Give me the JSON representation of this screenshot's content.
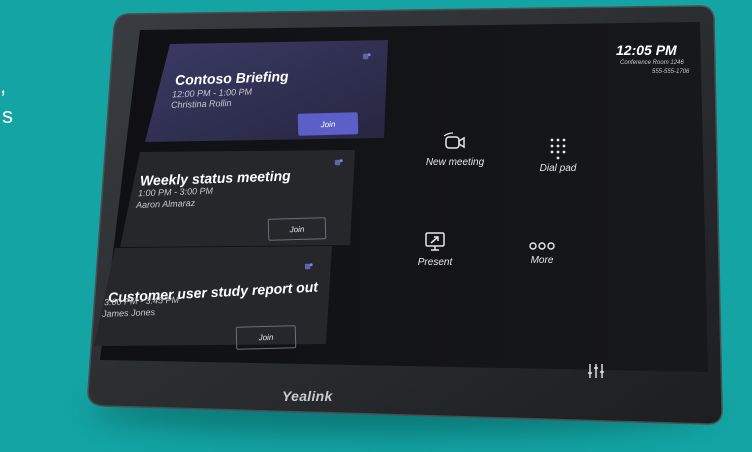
{
  "background_text": [
    ",",
    "s"
  ],
  "status": {
    "time": "12:05 PM",
    "room": "Conference Room 1246",
    "phone": "555-555-1706"
  },
  "meetings": [
    {
      "title": "Contoso Briefing",
      "time": "12:00 PM - 1:00 PM",
      "host": "Christina Rollin",
      "join_label": "Join"
    },
    {
      "title": "Weekly status meeting",
      "time": "1:00 PM - 3:00 PM",
      "host": "Aaron Almaraz",
      "join_label": "Join"
    },
    {
      "title": "Customer user study report out",
      "time": "3:00 PM - 3:45 PM",
      "host": "James Jones",
      "join_label": "Join"
    }
  ],
  "actions": {
    "new_meeting": "New meeting",
    "dial_pad": "Dial pad",
    "present": "Present",
    "more": "More"
  },
  "brand": "Yealink",
  "colors": {
    "accent": "#5b5fc7",
    "background": "#13a4a3",
    "screen": "#141518"
  }
}
